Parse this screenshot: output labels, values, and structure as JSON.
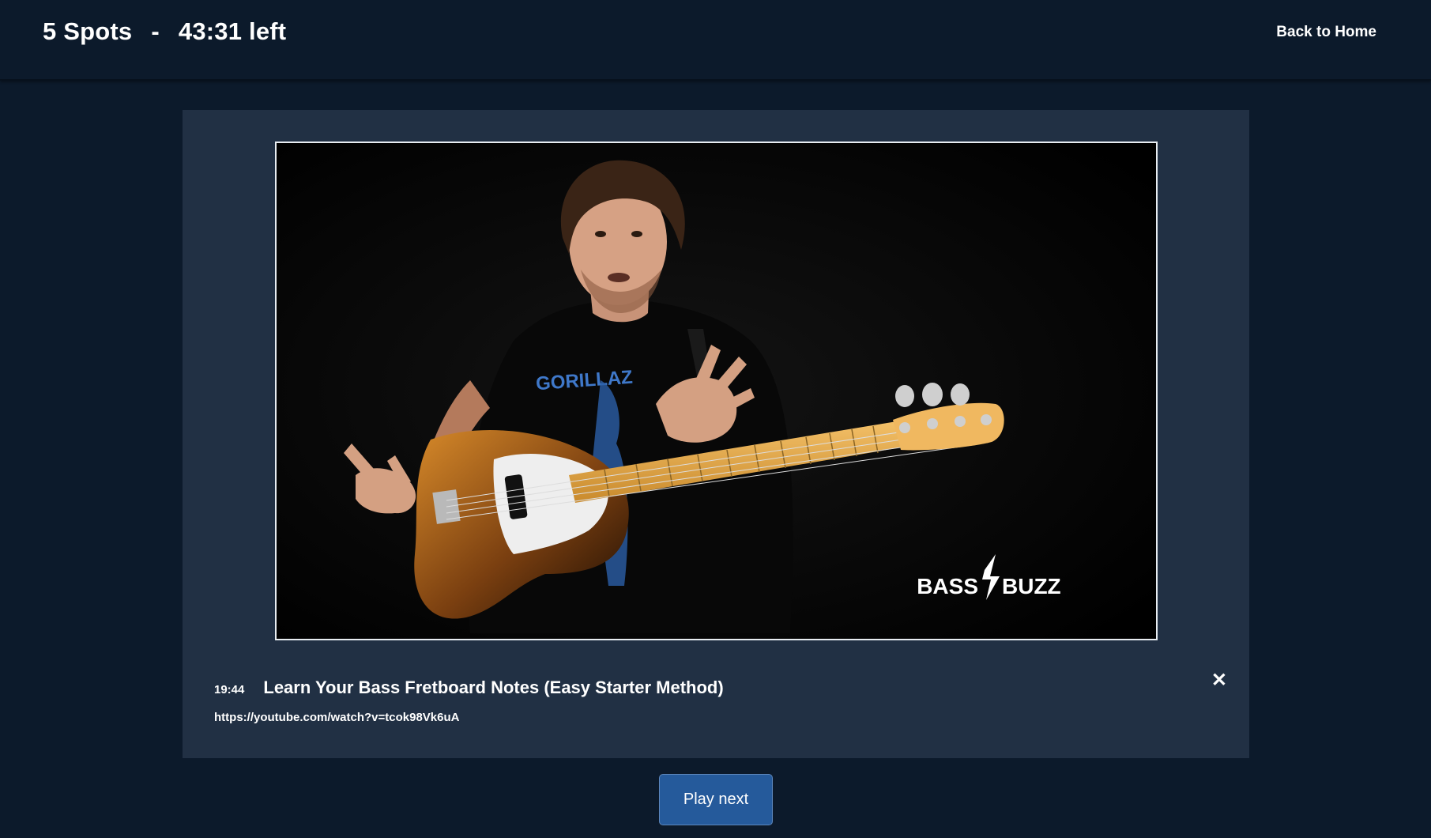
{
  "header": {
    "spots": "5 Spots",
    "separator": "-",
    "time_left": "43:31 left",
    "back_label": "Back to Home"
  },
  "video": {
    "duration": "19:44",
    "title": "Learn Your Bass Fretboard Notes (Easy Starter Method)",
    "url": "https://youtube.com/watch?v=tcok98Vk6uA",
    "thumbnail_logo_left": "BASS",
    "thumbnail_logo_right": "BUZZ",
    "shirt_text": "GORILLAZ"
  },
  "controls": {
    "close_glyph": "✕",
    "play_next_label": "Play next"
  },
  "colors": {
    "page_bg": "#0c1a2b",
    "card_bg": "#213044",
    "button_bg": "#255a9b"
  }
}
